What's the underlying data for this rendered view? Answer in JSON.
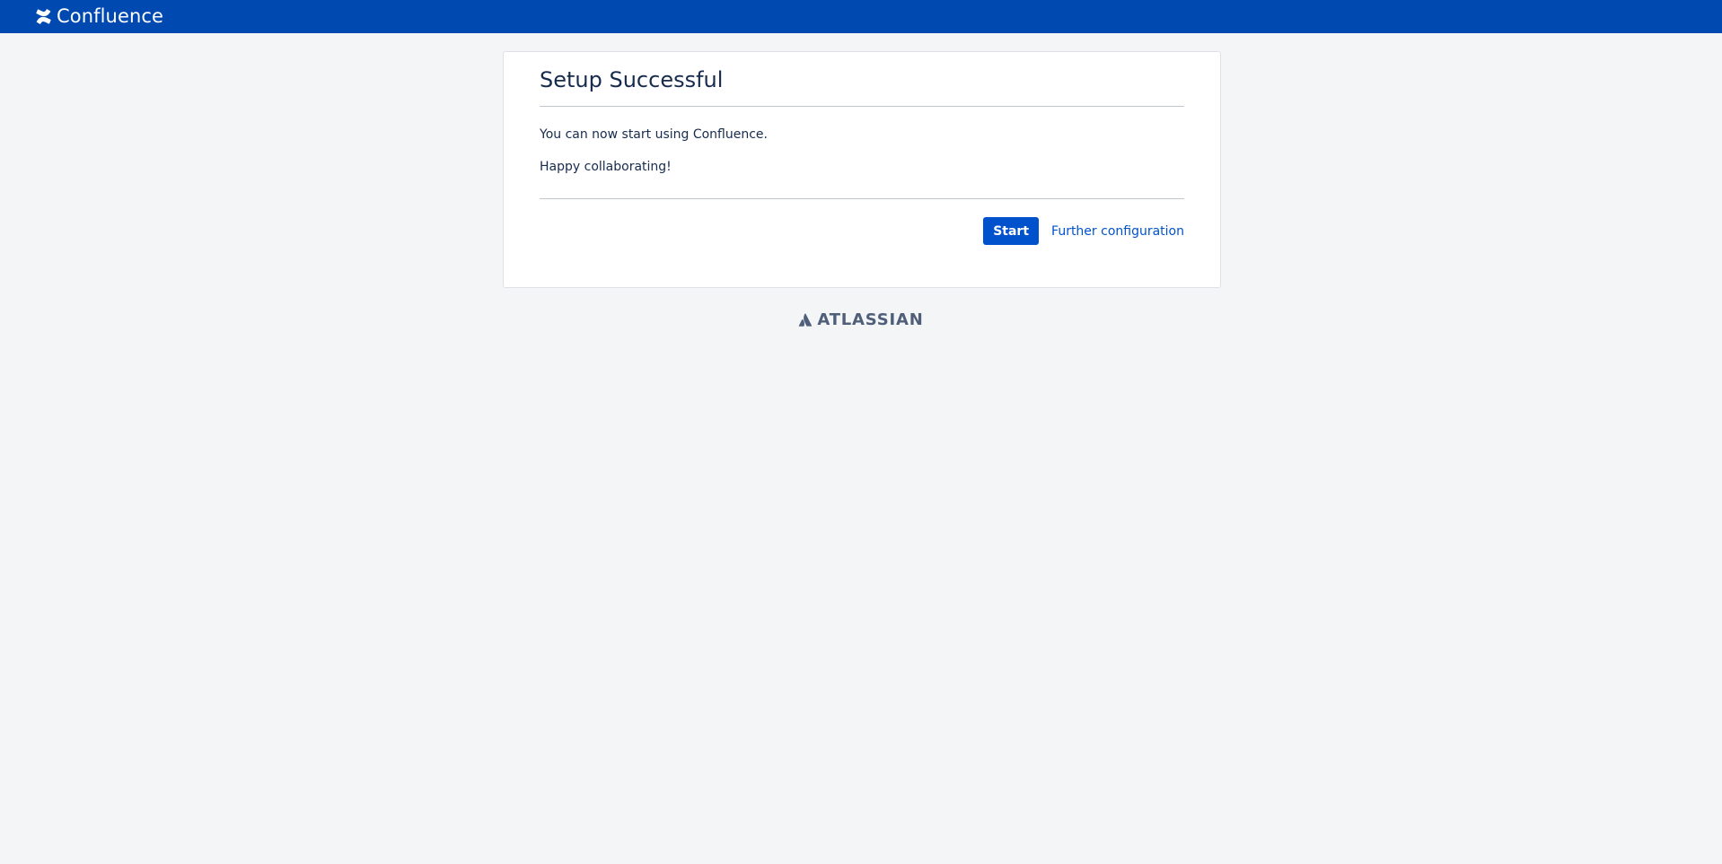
{
  "header": {
    "brand": "Confluence",
    "brand_icon": "confluence-logo-icon",
    "background_color": "#0049b0"
  },
  "card": {
    "title": "Setup Successful",
    "paragraphs": [
      "You can now start using Confluence.",
      "Happy collaborating!"
    ],
    "actions": {
      "primary_label": "Start",
      "link_label": "Further configuration"
    }
  },
  "footer": {
    "brand": "ATLASSIAN",
    "brand_icon": "atlassian-logo-icon"
  },
  "colors": {
    "accent": "#0052cc",
    "page_background": "#f4f5f7",
    "text": "#172b4d"
  }
}
